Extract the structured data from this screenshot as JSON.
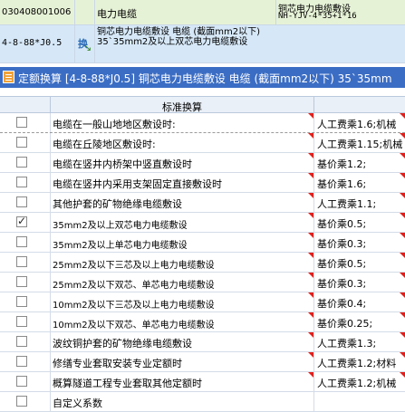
{
  "budget_rows": {
    "row1": {
      "code": "030408001006",
      "name": "电力电缆",
      "spec_line1": "铜芯电力电缆敷设",
      "spec_line2": "NH-YJV-4*35+1*16"
    },
    "row2": {
      "code": "4-8-88*J0.5",
      "icon": "conversion-icon",
      "desc": "铜芯电力电缆敷设 电缆 (截面mm2以下) 35`35mm2及以上双芯电力电缆敷设"
    }
  },
  "panel": {
    "title": "定额换算 [4-8-88*J0.5] 铜芯电力电缆敷设 电缆 (截面mm2以下) 35`35mm",
    "title_icon": "table-icon",
    "header_label": "标准换算",
    "rows": [
      {
        "checked": false,
        "name": "电缆在一般山地地区敷设时:",
        "expr": "人工费乘1.6;机械"
      },
      {
        "checked": false,
        "name": "电缆在丘陵地区敷设时:",
        "expr": "人工费乘1.15;机械"
      },
      {
        "checked": false,
        "name": "电缆在竖井内桥架中竖直敷设时",
        "expr": "基价乘1.2;"
      },
      {
        "checked": false,
        "name": "电缆在竖井内采用支架固定直接敷设时",
        "expr": "基价乘1.6;"
      },
      {
        "checked": false,
        "name": "其他护套的矿物绝缘电缆敷设",
        "expr": "人工费乘1.1;"
      },
      {
        "checked": true,
        "name": "35mm2及以上双芯电力电缆敷设",
        "expr": "基价乘0.5;"
      },
      {
        "checked": false,
        "name": "35mm2及以上单芯电力电缆敷设",
        "expr": "基价乘0.3;"
      },
      {
        "checked": false,
        "name": "25mm2及以下三芯及以上电力电缆敷设",
        "expr": "基价乘0.5;"
      },
      {
        "checked": false,
        "name": "25mm2及以下双芯、单芯电力电缆敷设",
        "expr": "基价乘0.3;"
      },
      {
        "checked": false,
        "name": "10mm2及以下三芯及以上电力电缆敷设",
        "expr": "基价乘0.4;"
      },
      {
        "checked": false,
        "name": "10mm2及以下双芯、单芯电力电缆敷设",
        "expr": "基价乘0.25;"
      },
      {
        "checked": false,
        "name": "波纹铜护套的矿物绝缘电缆敷设",
        "expr": "人工费乘1.3;"
      },
      {
        "checked": false,
        "name": "修缮专业套取安装专业定额时",
        "expr": "人工费乘1.2;材料"
      },
      {
        "checked": false,
        "name": "概算隧道工程专业套取其他定额时",
        "expr": "人工费乘1.2;机械"
      },
      {
        "checked": false,
        "name": "自定义系数",
        "expr": ""
      }
    ]
  },
  "colors": {
    "title_bar": "#3b6dc4",
    "row1_bg": "#e6f2d6",
    "row2_bg": "#d6e8f8",
    "marker_red": "#e0201c"
  }
}
